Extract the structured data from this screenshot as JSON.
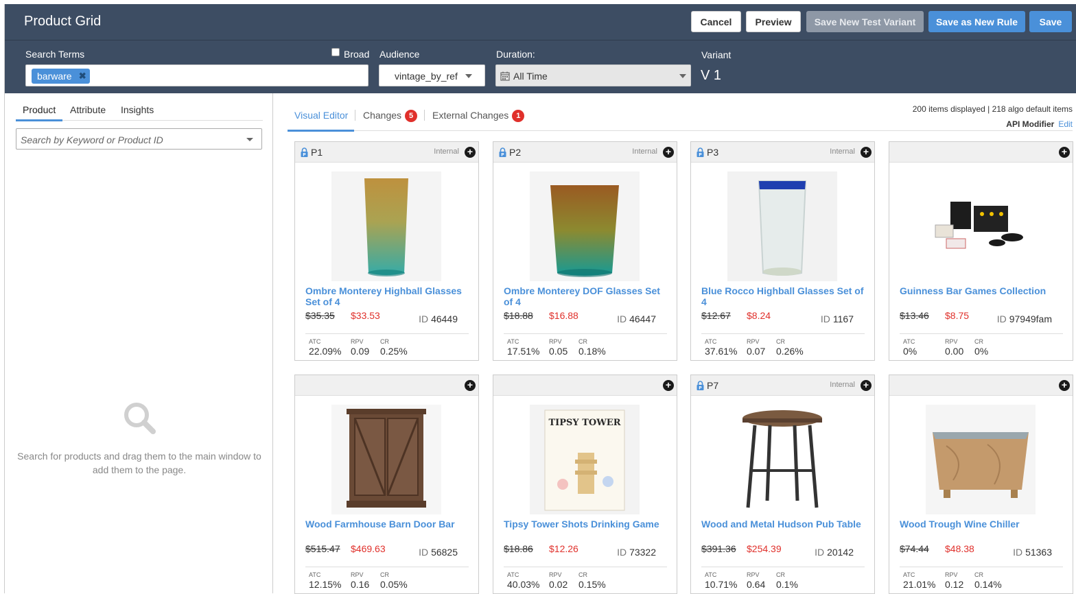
{
  "header": {
    "title": "Product Grid",
    "buttons": {
      "cancel": "Cancel",
      "preview": "Preview",
      "save_test_variant": "Save New Test Variant",
      "save_new_rule": "Save as New Rule",
      "save": "Save"
    }
  },
  "filters": {
    "search_terms_label": "Search Terms",
    "search_tag": "barware",
    "broad_label": "Broad",
    "broad_checked": false,
    "audience_label": "Audience",
    "audience_value": "vintage_by_ref",
    "duration_label": "Duration:",
    "duration_value": "All Time",
    "variant_label": "Variant",
    "variant_value": "V 1"
  },
  "left_panel": {
    "tabs": [
      "Product",
      "Attribute",
      "Insights"
    ],
    "active_tab": "Product",
    "search_placeholder": "Search by Keyword or Product ID",
    "empty_message": "Search for products and drag them to the main window to add them to the page."
  },
  "right_panel": {
    "tabs": {
      "visual_editor": "Visual Editor",
      "changes": "Changes",
      "changes_count": "5",
      "external_changes": "External Changes",
      "external_count": "1"
    },
    "items_info": "200 items displayed | 218 algo default items",
    "api_modifier_label": "API Modifier",
    "api_modifier_edit": "Edit",
    "stat_labels": {
      "atc": "ATC",
      "rpv": "RPV",
      "cr": "CR"
    },
    "id_label": "ID"
  },
  "products": [
    {
      "position": "P1",
      "locked": true,
      "internal": "Internal",
      "name": "Ombre Monterey Highball Glasses Set of 4",
      "old_price": "$35.35",
      "new_price": "$33.53",
      "id": "46449",
      "atc": "22.09%",
      "rpv": "0.09",
      "cr": "0.25%",
      "image": "ombre-highball"
    },
    {
      "position": "P2",
      "locked": true,
      "internal": "Internal",
      "name": "Ombre Monterey DOF Glasses Set of 4",
      "old_price": "$18.88",
      "new_price": "$16.88",
      "id": "46447",
      "atc": "17.51%",
      "rpv": "0.05",
      "cr": "0.18%",
      "image": "ombre-dof"
    },
    {
      "position": "P3",
      "locked": true,
      "internal": "Internal",
      "name": "Blue Rocco Highball Glasses Set of 4",
      "old_price": "$12.67",
      "new_price": "$8.24",
      "id": "1167",
      "atc": "37.61%",
      "rpv": "0.07",
      "cr": "0.26%",
      "image": "blue-rocco"
    },
    {
      "position": "",
      "locked": false,
      "internal": "",
      "name": "Guinness Bar Games Collection",
      "old_price": "$13.46",
      "new_price": "$8.75",
      "id": "97949fam",
      "atc": "0%",
      "rpv": "0.00",
      "cr": "0%",
      "image": "bar-games"
    },
    {
      "position": "",
      "locked": false,
      "internal": "",
      "name": "Wood Farmhouse Barn Door Bar",
      "old_price": "$515.47",
      "new_price": "$469.63",
      "id": "56825",
      "atc": "12.15%",
      "rpv": "0.16",
      "cr": "0.05%",
      "image": "barn-door-bar"
    },
    {
      "position": "",
      "locked": false,
      "internal": "",
      "name": "Tipsy Tower Shots Drinking Game",
      "old_price": "$18.86",
      "new_price": "$12.26",
      "id": "73322",
      "atc": "40.03%",
      "rpv": "0.02",
      "cr": "0.15%",
      "image": "tipsy-tower"
    },
    {
      "position": "P7",
      "locked": true,
      "internal": "Internal",
      "name": "Wood and Metal Hudson Pub Table",
      "old_price": "$391.36",
      "new_price": "$254.39",
      "id": "20142",
      "atc": "10.71%",
      "rpv": "0.64",
      "cr": "0.1%",
      "image": "pub-table"
    },
    {
      "position": "",
      "locked": false,
      "internal": "",
      "name": "Wood Trough Wine Chiller",
      "old_price": "$74.44",
      "new_price": "$48.38",
      "id": "51363",
      "atc": "21.01%",
      "rpv": "0.12",
      "cr": "0.14%",
      "image": "wine-chiller"
    }
  ],
  "tipsy_box_text": "TIPSY TOWER",
  "colors": {
    "header_bg": "#3d4d63",
    "accent": "#4a90d9",
    "badge": "#e0302b",
    "price_sale": "#e0302b"
  }
}
